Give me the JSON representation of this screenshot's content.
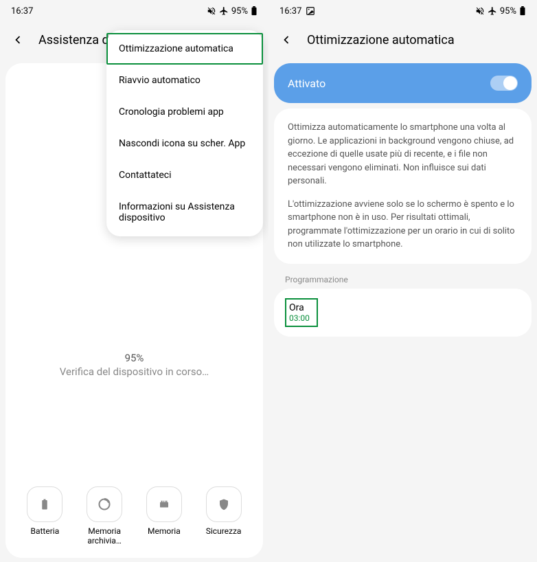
{
  "statusBar": {
    "time": "16:37",
    "battery": "95%"
  },
  "leftScreen": {
    "headerTitle": "Assistenza disposi",
    "menu": {
      "items": [
        "Ottimizzazione automatica",
        "Riavvio automatico",
        "Cronologia problemi app",
        "Nascondi icona su scher. App",
        "Contattateci",
        "Informazioni su Assistenza dispositivo"
      ]
    },
    "statusPercent": "95%",
    "statusText": "Verifica del dispositivo in corso…",
    "tiles": [
      {
        "label": "Batteria"
      },
      {
        "label": "Memoria archivia…"
      },
      {
        "label": "Memoria"
      },
      {
        "label": "Sicurezza"
      }
    ]
  },
  "rightScreen": {
    "headerTitle": "Ottimizzazione automatica",
    "toggleLabel": "Attivato",
    "description1": "Ottimizza automaticamente lo smartphone una volta al giorno. Le applicazioni in background vengono chiuse, ad eccezione di quelle usate più di recente, e i file non necessari vengono eliminati. Non influisce sui dati personali.",
    "description2": "L'ottimizzazione avviene solo se lo schermo è spento e lo smartphone non è in uso. Per risultati ottimali, programmate l'ottimizzazione per un orario in cui di solito non utilizzate lo smartphone.",
    "sectionLabel": "Programmazione",
    "scheduleTitle": "Ora",
    "scheduleTime": "03:00"
  }
}
